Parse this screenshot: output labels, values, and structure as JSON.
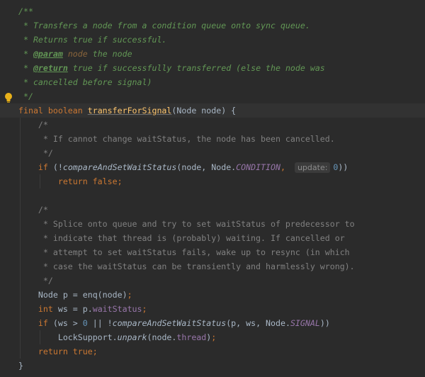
{
  "editor": {
    "language": "java",
    "method_name": "transferForSignal",
    "param_hint_label": "update:",
    "lines": [
      [
        {
          "t": "/**",
          "c": "doc"
        }
      ],
      [
        {
          "t": " * Transfers a node from a condition queue onto sync queue.",
          "c": "doc"
        }
      ],
      [
        {
          "t": " * Returns true if successful.",
          "c": "doc"
        }
      ],
      [
        {
          "t": " * ",
          "c": "doc"
        },
        {
          "t": "@param",
          "c": "doctag"
        },
        {
          "t": " node",
          "c": "param"
        },
        {
          "t": " the node",
          "c": "doc"
        }
      ],
      [
        {
          "t": " * ",
          "c": "doc"
        },
        {
          "t": "@return",
          "c": "doctag"
        },
        {
          "t": " true if successfully transferred (else the node was",
          "c": "doc"
        }
      ],
      [
        {
          "t": " * cancelled before signal)",
          "c": "doc"
        }
      ],
      [
        {
          "t": " */",
          "c": "doc"
        }
      ],
      [
        {
          "t": "final boolean ",
          "c": "kw"
        },
        {
          "t": "transferForSignal",
          "c": "method"
        },
        {
          "t": "(Node node) {",
          "c": "plain"
        }
      ],
      [
        {
          "t": "    /*",
          "c": "comment"
        }
      ],
      [
        {
          "t": "     * If cannot change waitStatus, the node has been cancelled.",
          "c": "comment"
        }
      ],
      [
        {
          "t": "     */",
          "c": "comment"
        }
      ],
      [
        {
          "t": "    if ",
          "c": "kw"
        },
        {
          "t": "(!",
          "c": "plain"
        },
        {
          "t": "compareAndSetWaitStatus",
          "c": "static-italic"
        },
        {
          "t": "(node, Node.",
          "c": "plain"
        },
        {
          "t": "CONDITION",
          "c": "const"
        },
        {
          "t": ", ",
          "c": "kw"
        },
        {
          "t": "update:",
          "c": "hint"
        },
        {
          "t": "0",
          "c": "num"
        },
        {
          "t": "))",
          "c": "plain"
        }
      ],
      [
        {
          "t": "        return false;",
          "c": "kw"
        }
      ],
      [],
      [
        {
          "t": "    /*",
          "c": "comment"
        }
      ],
      [
        {
          "t": "     * Splice onto queue and try to set waitStatus of predecessor to",
          "c": "comment"
        }
      ],
      [
        {
          "t": "     * indicate that thread is (probably) waiting. If cancelled or",
          "c": "comment"
        }
      ],
      [
        {
          "t": "     * attempt to set waitStatus fails, wake up to resync (in which",
          "c": "comment"
        }
      ],
      [
        {
          "t": "     * case the waitStatus can be transiently and harmlessly wrong).",
          "c": "comment"
        }
      ],
      [
        {
          "t": "     */",
          "c": "comment"
        }
      ],
      [
        {
          "t": "    Node p = enq(node)",
          "c": "plain"
        },
        {
          "t": ";",
          "c": "kw"
        }
      ],
      [
        {
          "t": "    int ",
          "c": "kw"
        },
        {
          "t": "ws = p.",
          "c": "plain"
        },
        {
          "t": "waitStatus",
          "c": "field"
        },
        {
          "t": ";",
          "c": "kw"
        }
      ],
      [
        {
          "t": "    if ",
          "c": "kw"
        },
        {
          "t": "(ws > ",
          "c": "plain"
        },
        {
          "t": "0",
          "c": "num"
        },
        {
          "t": " || !",
          "c": "plain"
        },
        {
          "t": "compareAndSetWaitStatus",
          "c": "static-italic"
        },
        {
          "t": "(p, ws, Node.",
          "c": "plain"
        },
        {
          "t": "SIGNAL",
          "c": "const"
        },
        {
          "t": "))",
          "c": "plain"
        }
      ],
      [
        {
          "t": "        LockSupport.",
          "c": "plain"
        },
        {
          "t": "unpark",
          "c": "static-italic"
        },
        {
          "t": "(node.",
          "c": "plain"
        },
        {
          "t": "thread",
          "c": "field"
        },
        {
          "t": ")",
          "c": "plain"
        },
        {
          "t": ";",
          "c": "kw"
        }
      ],
      [
        {
          "t": "    return true;",
          "c": "kw"
        }
      ],
      [
        {
          "t": "}",
          "c": "plain"
        }
      ]
    ]
  },
  "gutter": {
    "icon": "lightbulb-icon",
    "icon_color": "#e8b11a"
  },
  "colors": {
    "background": "#2b2b2b",
    "current_line": "#323232",
    "doc_comment": "#629755",
    "keyword": "#cc7832",
    "method_declaration": "#ffc66d",
    "constant": "#9876aa",
    "line_comment": "#808080",
    "number": "#6897bb",
    "plain": "#a9b7c6"
  }
}
